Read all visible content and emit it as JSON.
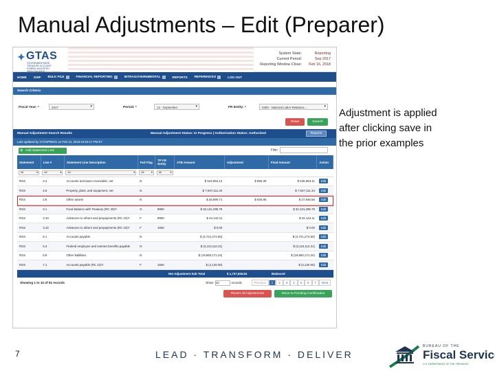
{
  "slide": {
    "title": "Manual Adjustments – Edit (Preparer)",
    "note": "Adjustment is applied after clicking save in the prior examples",
    "page_number": "7",
    "footer": "LEAD · TRANSFORM · DELIVER",
    "fs_logo": {
      "tiny": "BUREAU OF THE",
      "name": "Fiscal Service",
      "tag": "U.S. DEPARTMENT OF THE TREASURY"
    }
  },
  "app": {
    "logo": {
      "name": "GTAS",
      "sub": "GOVERNMENTWIDE TREASURY ACCOUNT SYMBOL ADJUSTED TRIAL BALANCE SYSTEM",
      "tag": "BUREAU OF THE FISCAL SERVICE"
    },
    "sysinfo": [
      {
        "k": "System State:",
        "v": "Reporting"
      },
      {
        "k": "Current Period:",
        "v": "Sep 2017"
      },
      {
        "k": "Reporting Window Close:",
        "v": "Feb 16, 2018"
      }
    ],
    "nav": [
      "HOME",
      "GWF",
      "BULK FILE",
      "FINANCIAL REPORTING",
      "INTRAGOVERNMENTAL",
      "REPORTS",
      "REFERENCES",
      "LOG OUT"
    ],
    "search_criteria": {
      "title": "Search Criteria",
      "fiscal_year_label": "Fiscal Year:",
      "fiscal_year": "2017",
      "period_label": "Period:",
      "period": "12 - September",
      "fr_entity_label": "FR Entity:",
      "fr_entity": "0300 - National Labor Relations ...",
      "required": "*",
      "reset": "Reset",
      "search": "Search"
    },
    "results": {
      "title": "Manual Adjustment Search Results",
      "status": "Manual Adjustment Status: In Progress | Authorization Status: Authorized",
      "report": "Reports",
      "updated": "Last updated by GTASPRE01 on Feb 13, 2018 04:53:17 PM ET",
      "add_button": "Add Statement Line",
      "filter_label": "Filter",
      "columns": [
        "Statement",
        "Line #",
        "Statement Line Description",
        "Fed Flag",
        "TP FR Entity",
        "ATB Amount",
        "Adjustment",
        "Final Amount",
        "Action"
      ],
      "filter_values": [
        "All",
        "All",
        "All",
        "All",
        "All"
      ],
      "rows": [
        [
          "RSS",
          "2.2",
          "Accounts and taxes receivable, net",
          "N",
          "",
          "$ 544,953.12",
          "$ 890.39",
          "$ 545,953.11",
          "Edit"
        ],
        [
          "RSS",
          "2.5",
          "Property, plant, and equipment, net",
          "N",
          "",
          "$ 7,947,111.34",
          "",
          "$ 7,947,111.34",
          "Edit"
        ],
        [
          "RSS",
          "2.8",
          "Other assets",
          "N",
          "",
          "$ 26,990.71",
          "$ 846.85",
          "$ 27,846.56",
          "Edit"
        ],
        [
          "RSS",
          "3.1",
          "Fund balance with Treasury (RC 40)Y",
          "G",
          "9900",
          "$ 32,131,295.79",
          "",
          "$ 32,131,295.79",
          "Edit"
        ],
        [
          "RSS",
          "3.10",
          "Advances to others and prepayments (RC 23)Y",
          "F",
          "9900",
          "$ 44,142.11",
          "",
          "$ 44,142.11",
          "Edit"
        ],
        [
          "RSS",
          "3.10",
          "Advances to others and prepayments (RC 23)Y",
          "F",
          "1600",
          "$ 0.00",
          "",
          "$ 0.00",
          "Edit"
        ],
        [
          "RSS",
          "6.1",
          "Accounts payable",
          "N",
          "",
          "$ (4,721,274.50)",
          "",
          "$ (4,721,274.50)",
          "Edit"
        ],
        [
          "RSS",
          "6.3",
          "Federal employee and veteran benefits payable",
          "N",
          "",
          "$ (3,110,112.21)",
          "",
          "$ (3,110,112.21)",
          "Edit"
        ],
        [
          "RSS",
          "6.9",
          "Other liabilities",
          "N",
          "",
          "$ (19,650,171.24)",
          "",
          "$ (19,650,171.24)",
          "Edit"
        ],
        [
          "RSS",
          "7.1",
          "Accounts payable (RC 22)Y",
          "F",
          "1500",
          "$ (4,120.00)",
          "",
          "$ (4,120.00)",
          "Edit"
        ]
      ],
      "total_label": "Net Adjustment Sub Total",
      "total_value": "$ 1,737,636.84",
      "total_status": "Balanced",
      "showing": "Showing 1 to 10 of 61 records",
      "show_label": "Show",
      "show_value": "10",
      "records_label": "records",
      "pages": [
        "Previous",
        "1",
        "2",
        "3",
        "4",
        "5",
        "6",
        "7",
        "Next"
      ],
      "revert": "Revert All Adjustments",
      "move": "Move to Pending Certification"
    }
  },
  "colors": {
    "nav": "#1f4e8c",
    "bar": "#2f6aa7",
    "red": "#d9534f",
    "green": "#3aa35a",
    "highlight": "#d9231f"
  }
}
